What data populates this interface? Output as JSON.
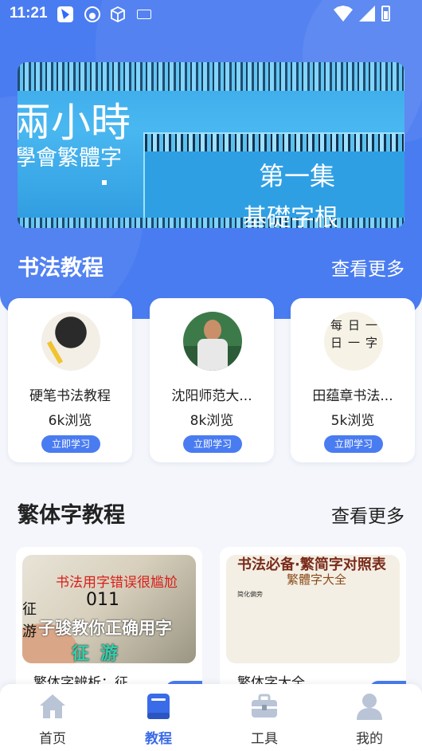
{
  "status_bar": {
    "time": "11:21"
  },
  "banner": {
    "line1": "兩小時",
    "line2": "學會繁體字",
    "line3": "第一集",
    "line4": "基礎字根"
  },
  "calligraphy_section": {
    "title": "书法教程",
    "more_label": "查看更多",
    "items": [
      {
        "name": "硬笔书法教程",
        "views": "6k浏览",
        "button": "立即学习"
      },
      {
        "name": "沈阳师范大...",
        "views": "8k浏览",
        "button": "立即学习"
      },
      {
        "name": "田蕴章书法...",
        "views": "5k浏览",
        "button": "立即学习"
      }
    ]
  },
  "traditional_section": {
    "title": "繁体字教程",
    "more_label": "查看更多",
    "items": [
      {
        "caption": "繁体字辨析：征...",
        "thumb": {
          "headline": "书法用字错误很尴尬",
          "number": "011",
          "left1": "征",
          "left2": "游",
          "subline": "子骏教你正确用字",
          "chars": "征游"
        }
      },
      {
        "caption": "繁体字大全",
        "thumb": {
          "headline": "书法必备·繁简字对照表",
          "subtitle": "繁體字大全",
          "row0": "简化偏旁"
        }
      }
    ]
  },
  "bottom_nav": {
    "items": [
      {
        "label": "首页",
        "icon": "home-icon",
        "active": false
      },
      {
        "label": "教程",
        "icon": "book-icon",
        "active": true
      },
      {
        "label": "工具",
        "icon": "toolbox-icon",
        "active": false
      },
      {
        "label": "我的",
        "icon": "user-icon",
        "active": false
      }
    ]
  },
  "colors": {
    "primary": "#4a7cf1",
    "active_nav": "#3a6be8",
    "background": "#f4f6fb"
  }
}
